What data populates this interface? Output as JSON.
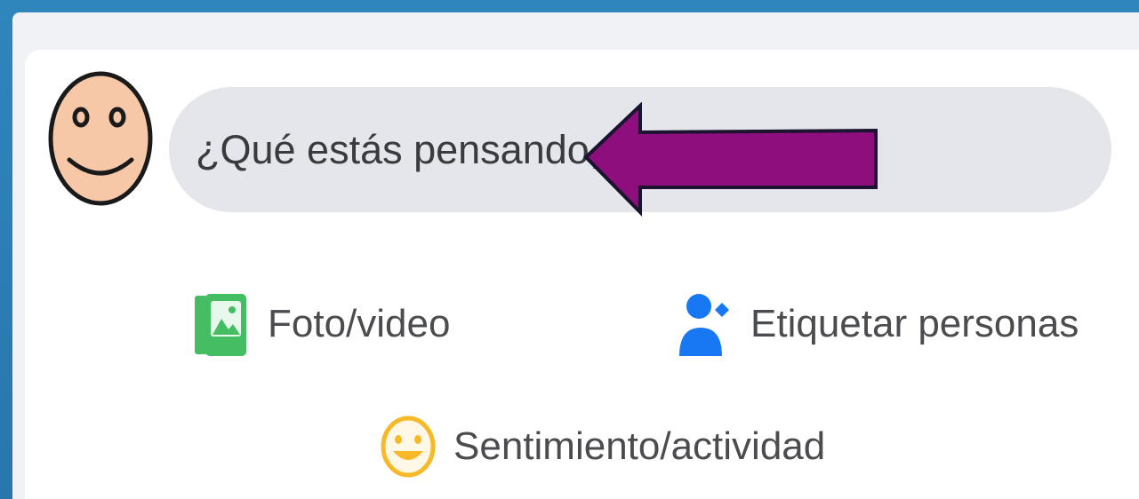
{
  "composer": {
    "placeholder": "¿Qué estás pensando, G"
  },
  "actions": {
    "photo_label": "Foto/video",
    "tag_label": "Etiquetar personas",
    "feeling_label": "Sentimiento/actividad"
  },
  "icons": {
    "avatar": "smiley-face-avatar",
    "photo": "photo-gallery-icon",
    "tag": "person-tag-icon",
    "feeling": "smiley-feeling-icon",
    "annotation": "left-arrow-icon"
  },
  "colors": {
    "frame": "#2a7bb0",
    "card": "#ffffff",
    "input_bg": "#e4e6eb",
    "photo_green": "#45bd62",
    "tag_blue": "#1877f2",
    "feeling_yellow": "#f7b928",
    "arrow_purple": "#8e0e7e",
    "avatar_skin": "#f7c8a8"
  }
}
